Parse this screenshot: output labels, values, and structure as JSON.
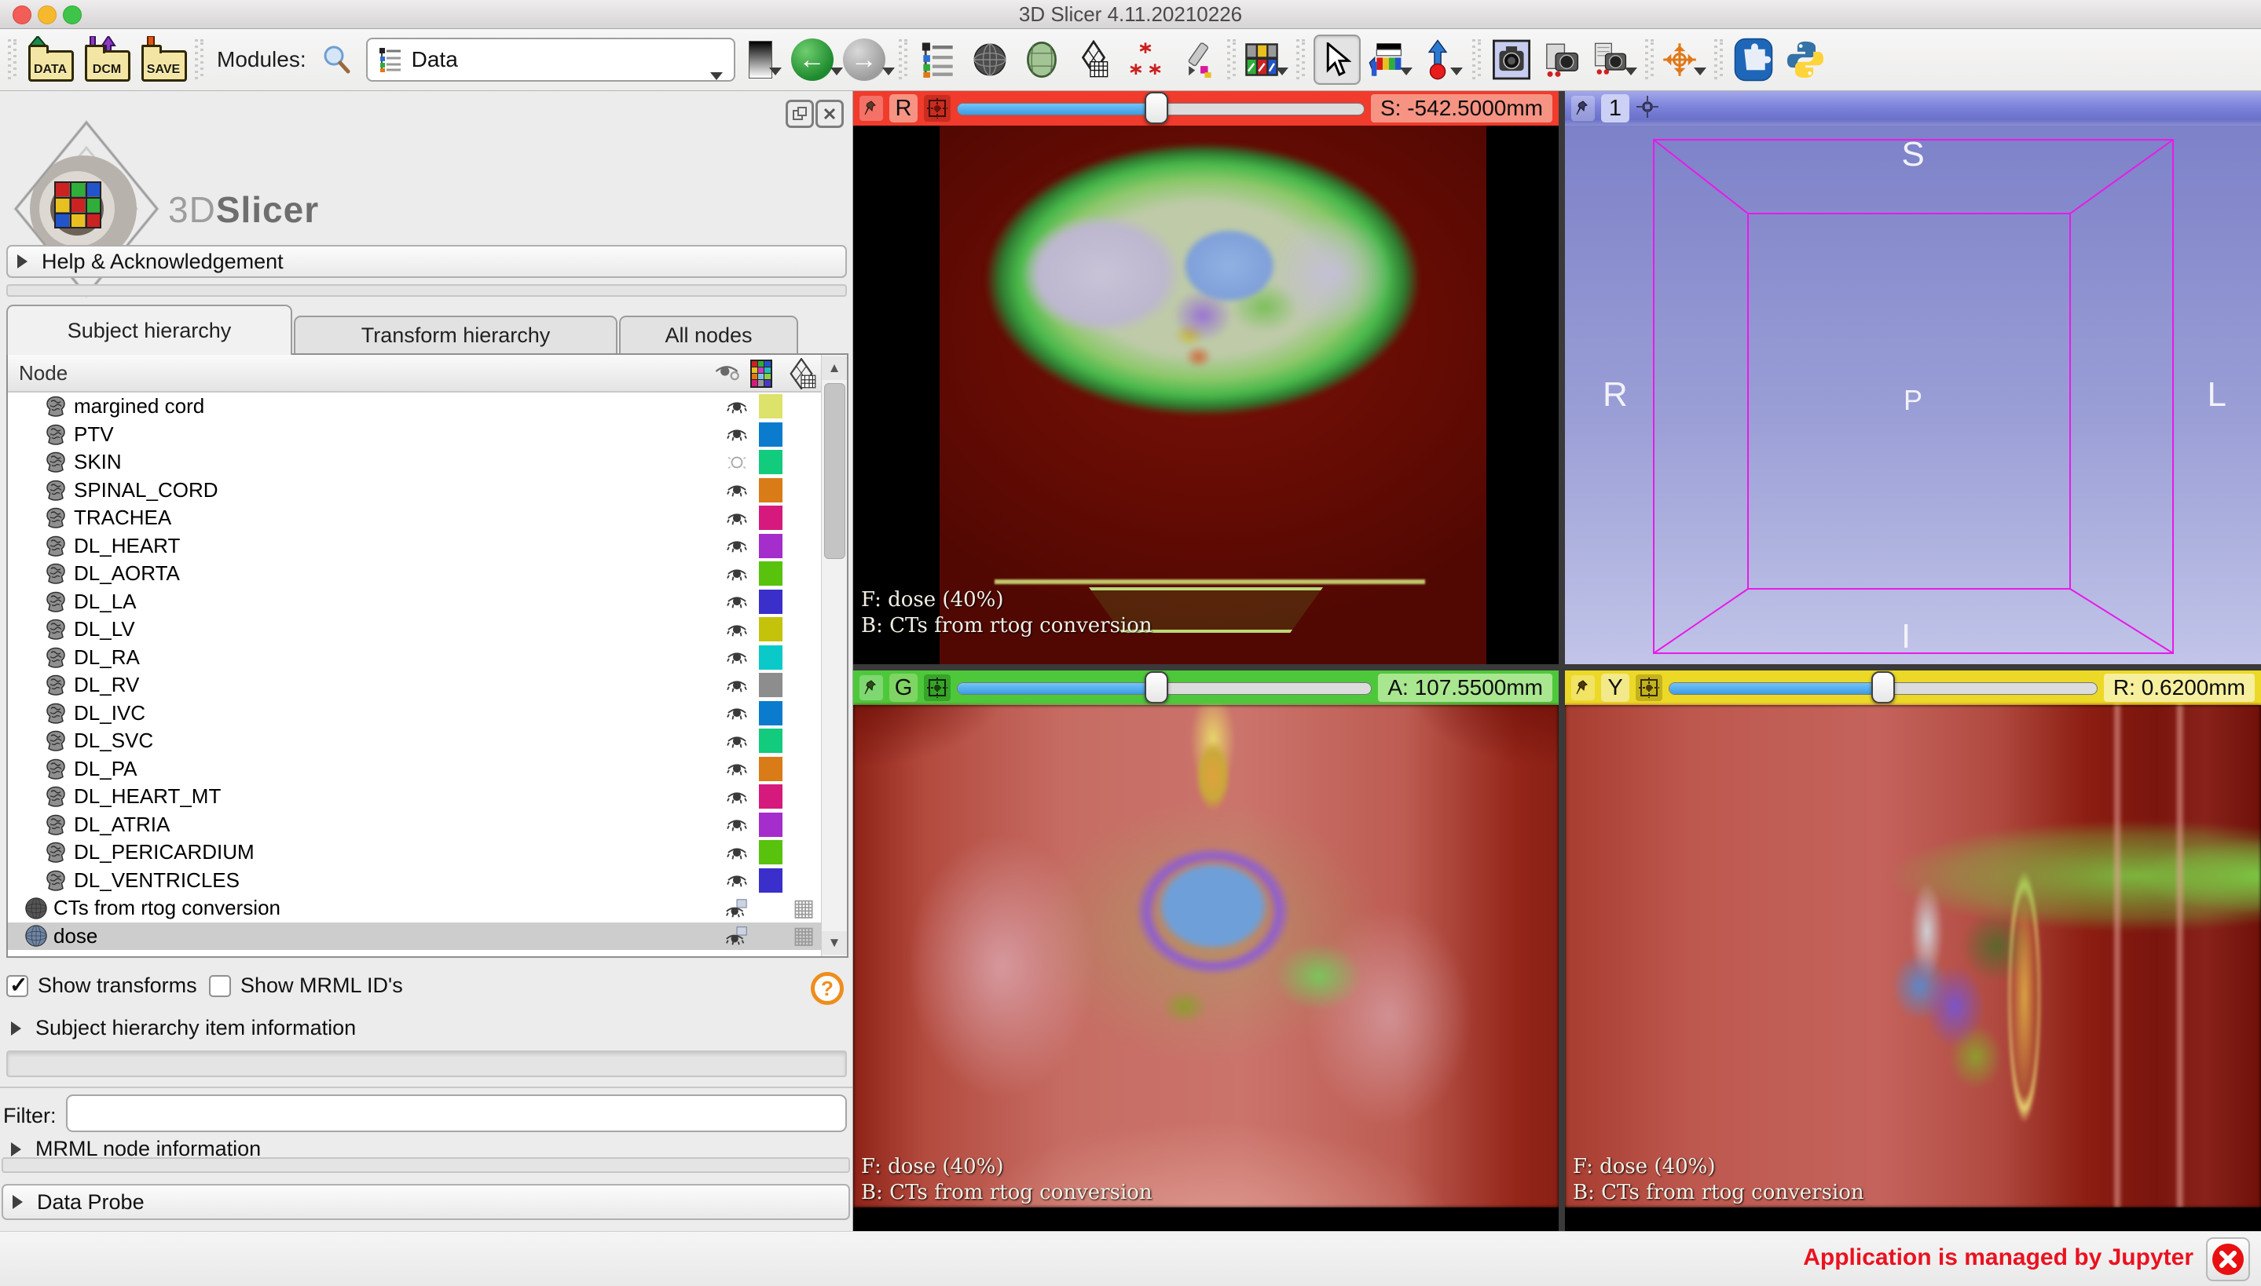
{
  "window": {
    "title": "3D Slicer 4.11.20210226"
  },
  "toolbar": {
    "load_data_label": "DATA",
    "load_dicom_label": "DCM",
    "save_label": "SAVE",
    "modules_label": "Modules:",
    "module_selected": "Data"
  },
  "left_panel": {
    "logo_3d": "3D",
    "logo_slicer": "Slicer",
    "help_section_label": "Help & Acknowledgement",
    "tabs": [
      {
        "label": "Subject hierarchy",
        "selected": true
      },
      {
        "label": "Transform hierarchy",
        "selected": false
      },
      {
        "label": "All nodes",
        "selected": false
      }
    ],
    "tree": {
      "node_column_header": "Node",
      "items": [
        {
          "label": "margined cord",
          "type": "segmentation",
          "color": "#dde26b",
          "visible": true
        },
        {
          "label": "PTV",
          "type": "segmentation",
          "color": "#0b7ccd",
          "visible": true
        },
        {
          "label": "SKIN",
          "type": "segmentation",
          "color": "#12cb7d",
          "visible": false
        },
        {
          "label": "SPINAL_CORD",
          "type": "segmentation",
          "color": "#d97b17",
          "visible": true
        },
        {
          "label": "TRACHEA",
          "type": "segmentation",
          "color": "#d61a7d",
          "visible": true
        },
        {
          "label": "DL_HEART",
          "type": "segmentation",
          "color": "#a42dcc",
          "visible": true
        },
        {
          "label": "DL_AORTA",
          "type": "segmentation",
          "color": "#58c20c",
          "visible": true
        },
        {
          "label": "DL_LA",
          "type": "segmentation",
          "color": "#3a2fcb",
          "visible": true
        },
        {
          "label": "DL_LV",
          "type": "segmentation",
          "color": "#c4c20b",
          "visible": true
        },
        {
          "label": "DL_RA",
          "type": "segmentation",
          "color": "#0cc9c9",
          "visible": true
        },
        {
          "label": "DL_RV",
          "type": "segmentation",
          "color": "#8d8d8d",
          "visible": true
        },
        {
          "label": "DL_IVC",
          "type": "segmentation",
          "color": "#0b7ccd",
          "visible": true
        },
        {
          "label": "DL_SVC",
          "type": "segmentation",
          "color": "#12cb7d",
          "visible": true
        },
        {
          "label": "DL_PA",
          "type": "segmentation",
          "color": "#d97b17",
          "visible": true
        },
        {
          "label": "DL_HEART_MT",
          "type": "segmentation",
          "color": "#d61a7d",
          "visible": true
        },
        {
          "label": "DL_ATRIA",
          "type": "segmentation",
          "color": "#a42dcc",
          "visible": true
        },
        {
          "label": "DL_PERICARDIUM",
          "type": "segmentation",
          "color": "#58c20c",
          "visible": true
        },
        {
          "label": "DL_VENTRICLES",
          "type": "segmentation",
          "color": "#3a2fcb",
          "visible": true
        },
        {
          "label": "CTs from rtog conversion",
          "type": "volume",
          "visible": true
        },
        {
          "label": "dose",
          "type": "volume",
          "visible": true,
          "selected": true
        }
      ]
    },
    "show_transforms": {
      "label": "Show transforms",
      "checked": true
    },
    "show_mrml_ids": {
      "label": "Show MRML ID's",
      "checked": false
    },
    "item_information_label": "Subject hierarchy item information",
    "filter_label": "Filter:",
    "filter_value": "",
    "mrml_information_label": "MRML node information",
    "data_probe_label": "Data Probe"
  },
  "views": {
    "red": {
      "letter": "R",
      "value_label": "S: -542.5000mm",
      "slider_fraction": 0.49,
      "foreground_label": "F: dose (40%)",
      "background_label": "B: CTs from rtog conversion"
    },
    "green": {
      "letter": "G",
      "value_label": "A: 107.5500mm",
      "slider_fraction": 0.48,
      "foreground_label": "F: dose (40%)",
      "background_label": "B: CTs from rtog conversion"
    },
    "yellow": {
      "letter": "Y",
      "value_label": "R: 0.6200mm",
      "slider_fraction": 0.5,
      "foreground_label": "F: dose (40%)",
      "background_label": "B: CTs from rtog conversion"
    },
    "threeD": {
      "label": "1",
      "orientation": {
        "top": "S",
        "left": "R",
        "center": "P",
        "right": "L",
        "bottom": "I"
      }
    }
  },
  "status_bar": {
    "jupyter_message": "Application is managed by Jupyter"
  },
  "colors": {
    "red_view": "#f03b2d",
    "green_view": "#4ec83b",
    "yellow_view": "#ecd927",
    "threed_view": "#7d83da",
    "slider_fill": "#49a8ee"
  }
}
